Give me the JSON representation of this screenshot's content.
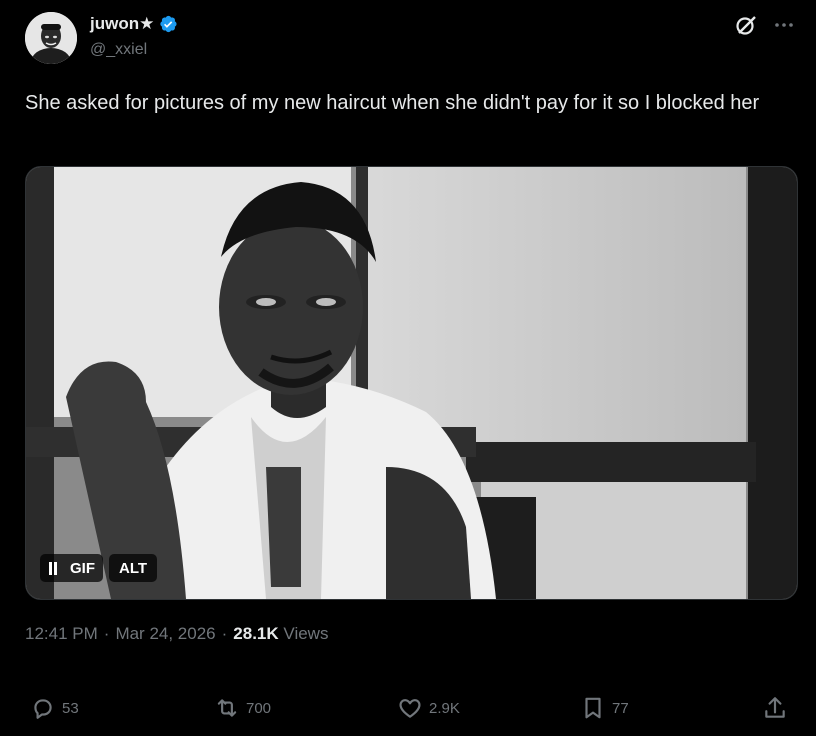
{
  "author": {
    "display_name": "juwon★",
    "handle": "@_xxiel",
    "verified": true
  },
  "icons": {
    "verified": "verified-badge-icon",
    "grok": "grok-icon",
    "more": "more-options-icon",
    "reply": "reply-icon",
    "repost": "repost-icon",
    "like": "heart-icon",
    "bookmark": "bookmark-icon",
    "share": "share-icon"
  },
  "tweet": {
    "text": "She asked for pictures of my new haircut when she didn't pay for it so I blocked her"
  },
  "media": {
    "type": "gif",
    "gif_label": "GIF",
    "alt_label": "ALT"
  },
  "meta": {
    "time": "12:41 PM",
    "separator1": "·",
    "date": "Mar 24, 2026",
    "separator2": "·",
    "views_count": "28.1K",
    "views_label": "Views"
  },
  "actions": {
    "replies": "53",
    "reposts": "700",
    "likes": "2.9K",
    "bookmarks": "77"
  },
  "colors": {
    "background": "#000000",
    "text_primary": "#e7e9ea",
    "text_secondary": "#71767b",
    "verified_blue": "#1d9bf0"
  }
}
